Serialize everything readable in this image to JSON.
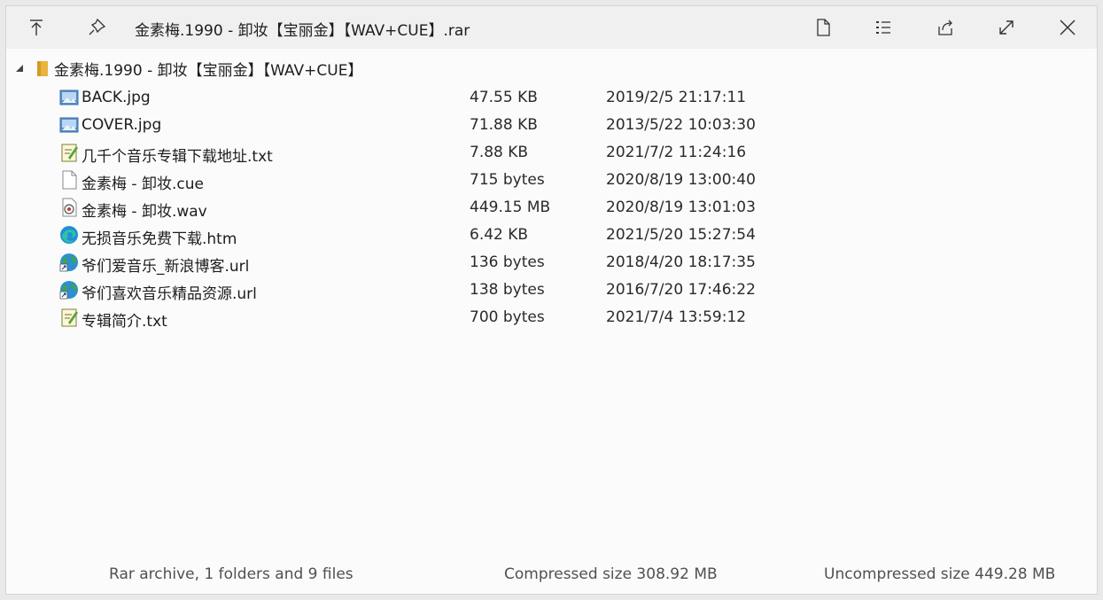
{
  "window": {
    "title": "金素梅.1990 - 卸妆【宝丽金】【WAV+CUE】.rar"
  },
  "toolbar": {
    "extract_icon": "extract-up-arrow-icon",
    "pin_icon": "pin-icon",
    "new_file_icon": "document-icon",
    "list_icon": "list-icon",
    "share_icon": "share-icon",
    "maximize_icon": "maximize-icon",
    "close_icon": "close-icon"
  },
  "tree": {
    "root_label": "金素梅.1990 - 卸妆【宝丽金】【WAV+CUE】",
    "files": [
      {
        "name": "BACK.jpg",
        "size": "47.55 KB",
        "date": "2019/2/5 21:17:11",
        "icon": "image-file-icon"
      },
      {
        "name": "COVER.jpg",
        "size": "71.88 KB",
        "date": "2013/5/22 10:03:30",
        "icon": "image-file-icon"
      },
      {
        "name": "几千个音乐专辑下载地址.txt",
        "size": "7.88 KB",
        "date": "2021/7/2 11:24:16",
        "icon": "text-file-icon"
      },
      {
        "name": "金素梅 - 卸妆.cue",
        "size": "715 bytes",
        "date": "2020/8/19 13:00:40",
        "icon": "blank-file-icon"
      },
      {
        "name": "金素梅 - 卸妆.wav",
        "size": "449.15 MB",
        "date": "2020/8/19 13:01:03",
        "icon": "audio-file-icon"
      },
      {
        "name": "无损音乐免费下载.htm",
        "size": "6.42 KB",
        "date": "2021/5/20 15:27:54",
        "icon": "edge-browser-icon"
      },
      {
        "name": "爷们爱音乐_新浪博客.url",
        "size": "136 bytes",
        "date": "2018/4/20 18:17:35",
        "icon": "url-shortcut-icon"
      },
      {
        "name": "爷们喜欢音乐精品资源.url",
        "size": "138 bytes",
        "date": "2016/7/20 17:46:22",
        "icon": "url-shortcut-icon"
      },
      {
        "name": "专辑简介.txt",
        "size": "700 bytes",
        "date": "2021/7/4 13:59:12",
        "icon": "text-file-icon"
      }
    ]
  },
  "status": {
    "summary": "Rar archive, 1 folders and 9 files",
    "compressed": "Compressed size 308.92 MB",
    "uncompressed": "Uncompressed size 449.28 MB"
  },
  "colors": {
    "folder": "#e8b43c",
    "titlebar_bg": "#f0f0f0",
    "window_bg": "#fbfbfb"
  }
}
